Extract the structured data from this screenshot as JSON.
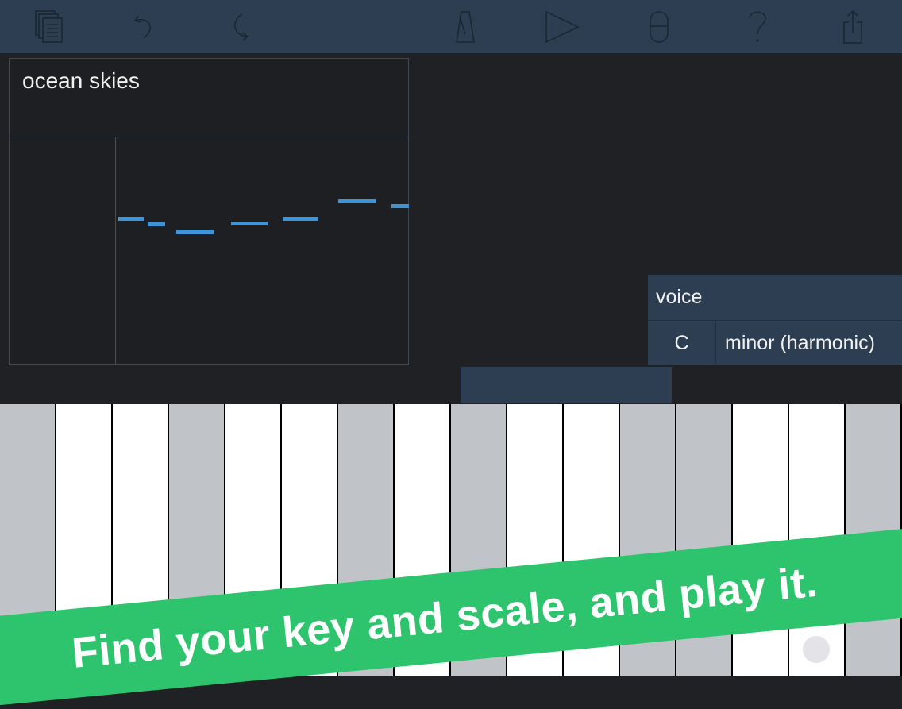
{
  "toolbar": {
    "icons": [
      "documents-icon",
      "undo-icon",
      "redo-icon",
      "metronome-icon",
      "play-icon",
      "cylinder-icon",
      "help-icon",
      "share-icon"
    ]
  },
  "song": {
    "title": "ocean skies"
  },
  "voice": {
    "label": "voice",
    "key": "C",
    "scale": "minor (harmonic)"
  },
  "keyboard": {
    "keys": [
      "grey",
      "white",
      "white",
      "grey",
      "white",
      "white",
      "grey",
      "white",
      "grey",
      "white",
      "white",
      "grey",
      "grey",
      "white",
      "white",
      "grey"
    ]
  },
  "banner": {
    "text": "Find your key and scale, and play it."
  },
  "colors": {
    "toolbar": "#2e3e52",
    "background": "#202124",
    "note": "#3d94d6",
    "banner": "#2ec46e",
    "key_white": "#ffffff",
    "key_grey": "#c0c4c9"
  }
}
